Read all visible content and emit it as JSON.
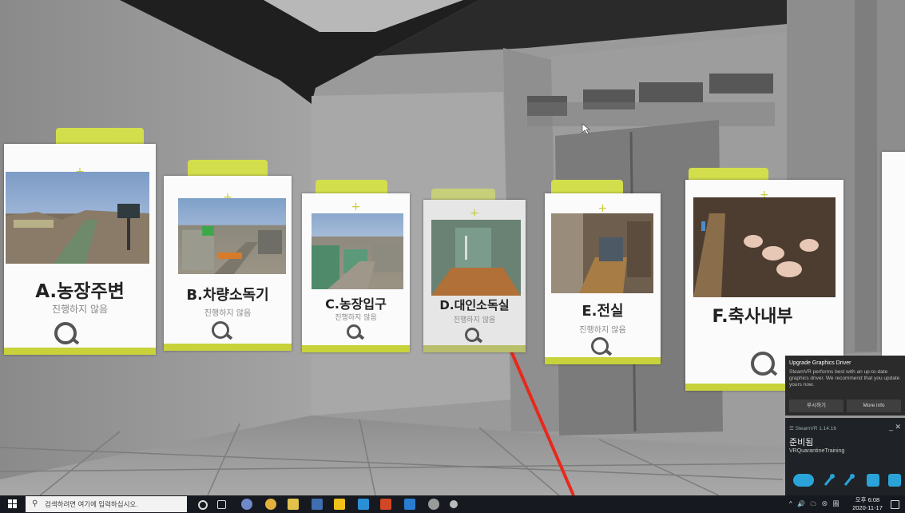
{
  "cards": [
    {
      "title": "A.농장주변",
      "status": "진행하지 않음"
    },
    {
      "title": "B.차량소독기",
      "status": "진행하지 않음"
    },
    {
      "title": "C.농장입구",
      "status": "진행하지 않음"
    },
    {
      "title": "D.대인소독실",
      "status": "진행하지 않음"
    },
    {
      "title": "E.전실",
      "status": "진행하지 않음"
    },
    {
      "title": "F.축사내부",
      "status": ""
    }
  ],
  "card_plus": "+",
  "notification": {
    "title": "Upgrade Graphics Driver",
    "message": "SteamVR performs best with an up-to-date graphics driver. We recommend that you update yours now.",
    "dismiss_label": "무시하기",
    "more_info_label": "More info"
  },
  "steamvr": {
    "version": "☰ SteamVR 1.14.16",
    "status": "준비됨",
    "app": "VRQuarantineTraining",
    "controls": "_ ✕"
  },
  "taskbar": {
    "search_placeholder": "검색하려면 여기에 입력하십시오.",
    "tray_symbols": "^ 🔊 ☁ ⊗ 圖",
    "time": "오후 6:08",
    "date": "2020-11-17"
  },
  "colors": {
    "card_accent": "#d3de4c",
    "laser": "#e8281c",
    "taskbar": "#161a20"
  }
}
